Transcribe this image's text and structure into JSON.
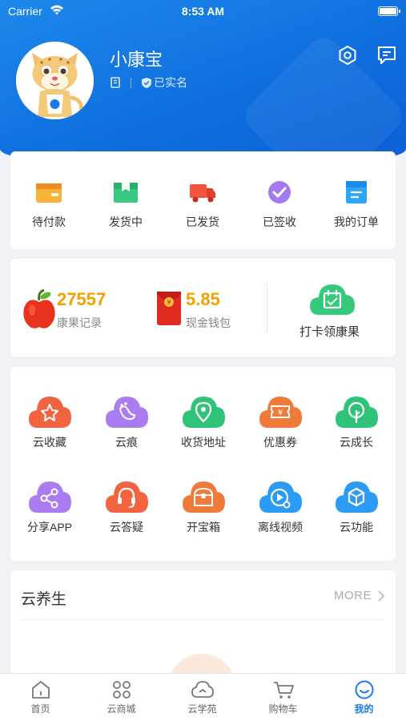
{
  "status_bar": {
    "carrier": "Carrier",
    "time": "8:53 AM"
  },
  "profile": {
    "name": "小康宝",
    "verified_label": "已实名",
    "icons": [
      "book-icon",
      "shield-check-icon",
      "settings-hexagon-icon",
      "message-icon"
    ]
  },
  "orders": [
    {
      "label": "待付款",
      "icon": "wallet-icon",
      "color": "#f5a623"
    },
    {
      "label": "发货中",
      "icon": "box-icon",
      "color": "#2fc37a"
    },
    {
      "label": "已发货",
      "icon": "truck-icon",
      "color": "#f0523a"
    },
    {
      "label": "已签收",
      "icon": "check-circle-icon",
      "color": "#9b6cf0"
    },
    {
      "label": "我的订单",
      "icon": "order-list-icon",
      "color": "#2b9cf5"
    }
  ],
  "assets": {
    "apple_value": "27557",
    "apple_label": "康果记录",
    "wallet_value": "5.85",
    "wallet_label": "现金钱包",
    "checkin_label": "打卡领康果"
  },
  "features": [
    {
      "label": "云收藏",
      "icon": "star-icon",
      "color": "#f2633f"
    },
    {
      "label": "云痕",
      "icon": "footprint-icon",
      "color": "#a877ee"
    },
    {
      "label": "收货地址",
      "icon": "location-pin-icon",
      "color": "#2fc37a"
    },
    {
      "label": "优惠券",
      "icon": "coupon-icon",
      "color": "#f07a3a"
    },
    {
      "label": "云成长",
      "icon": "tree-icon",
      "color": "#2fc37a"
    },
    {
      "label": "分享APP",
      "icon": "share-icon",
      "color": "#a877ee"
    },
    {
      "label": "云答疑",
      "icon": "headset-icon",
      "color": "#f2633f"
    },
    {
      "label": "开宝箱",
      "icon": "treasure-chest-icon",
      "color": "#f07a3a"
    },
    {
      "label": "离线视频",
      "icon": "video-disc-icon",
      "color": "#2b9cf5"
    },
    {
      "label": "云功能",
      "icon": "cube-icon",
      "color": "#2b9cf5"
    }
  ],
  "wellness": {
    "title": "云养生",
    "more_label": "MORE"
  },
  "tabbar": {
    "active": "我的",
    "tabs": [
      {
        "label": "首页",
        "icon": "home-icon"
      },
      {
        "label": "云商城",
        "icon": "grid-icon"
      },
      {
        "label": "云学苑",
        "icon": "cloud-icon"
      },
      {
        "label": "购物车",
        "icon": "cart-icon"
      },
      {
        "label": "我的",
        "icon": "smile-icon"
      }
    ]
  },
  "colors": {
    "brand_blue": "#1a7ae8",
    "value_orange": "#f5a000"
  }
}
